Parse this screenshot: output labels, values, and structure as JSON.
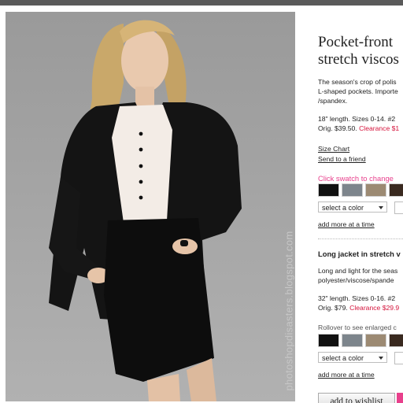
{
  "watermark": "photoshopdisasters.blogspot.com",
  "product1": {
    "title_line1": "Pocket-front",
    "title_line2": "stretch viscos",
    "desc_line1": "The season's crop of polis",
    "desc_line2": "L-shaped pockets. Importe",
    "desc_line3": "/spandex.",
    "length_line": "18\" length. Sizes 0-14. #2",
    "orig_price": "Orig. $39.50.",
    "clearance": "Clearance $1",
    "size_chart": "Size Chart",
    "send_friend": "Send to a friend",
    "swatch_prompt": "Click swatch to change",
    "swatch_colors": [
      "#111111",
      "#7d858c",
      "#9c8a73",
      "#3a2a20"
    ],
    "select_value": "select a color",
    "add_more": "add more at a time"
  },
  "product2": {
    "title": "Long jacket in stretch v",
    "desc_line1": "Long and light for the seas",
    "desc_line2": "polyester/viscose/spande",
    "length_line": "32\" length. Sizes 0-16. #2",
    "orig_price": "Orig. $79.",
    "clearance": "Clearance $29.9",
    "rollover": "Rollover to see enlarged c",
    "swatch_colors": [
      "#111111",
      "#7d858c",
      "#9c8a73",
      "#3a2a20"
    ],
    "select_value": "select a color",
    "add_more": "add more at a time"
  },
  "wishlist_label": "add to wishlist",
  "colors": {
    "clearance": "#d5143c",
    "accent_pink": "#e8408c"
  }
}
